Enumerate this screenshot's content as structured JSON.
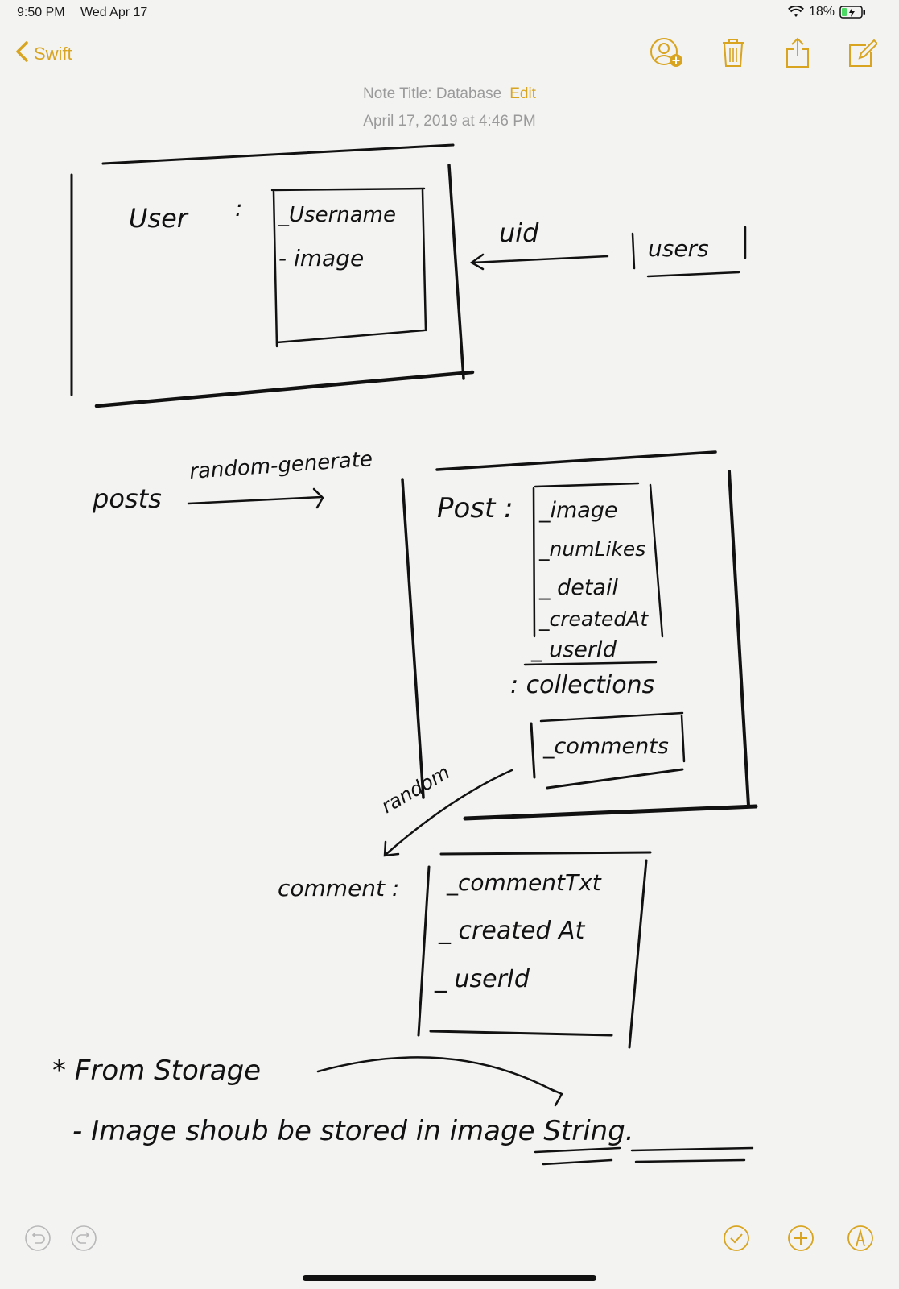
{
  "status_bar": {
    "time": "9:50 PM",
    "date": "Wed Apr 17",
    "battery": "18%",
    "icons": [
      "wifi-icon",
      "battery-charging-icon"
    ]
  },
  "nav": {
    "back_label": "Swift",
    "icons": [
      "add-person-icon",
      "trash-icon",
      "share-icon",
      "compose-icon"
    ]
  },
  "note": {
    "title_line": "Note Title: Database",
    "edit_label": "Edit",
    "date": "April 17, 2019 at 4:46 PM"
  },
  "sketch": {
    "user_label": "User",
    "colon": ":",
    "user_fields": [
      "_Username",
      "- image"
    ],
    "uid_label": "uid",
    "users_collection": "users",
    "posts_label": "posts",
    "random_generate": "random-generate",
    "post_label": "Post :",
    "post_fields": [
      "_image",
      "_numLikes",
      "_ detail",
      "_createdAt",
      "_ userId"
    ],
    "collections_label": ": collections",
    "comments_collection": "_comments",
    "random_label": "random",
    "comment_label": "comment :",
    "comment_fields": [
      "_commentTxt",
      "_ created At",
      "_ userId"
    ],
    "note_line_1": "* From Storage",
    "note_line_2": "- Image shoub be stored in image String."
  },
  "bottom_bar": {
    "icons": [
      "undo-icon",
      "redo-icon",
      "checklist-icon",
      "add-icon",
      "markup-icon"
    ]
  },
  "colors": {
    "accent": "#d9a520",
    "background": "#f3f3f2",
    "meta_text": "#9a9a9a",
    "ink": "#111111"
  }
}
